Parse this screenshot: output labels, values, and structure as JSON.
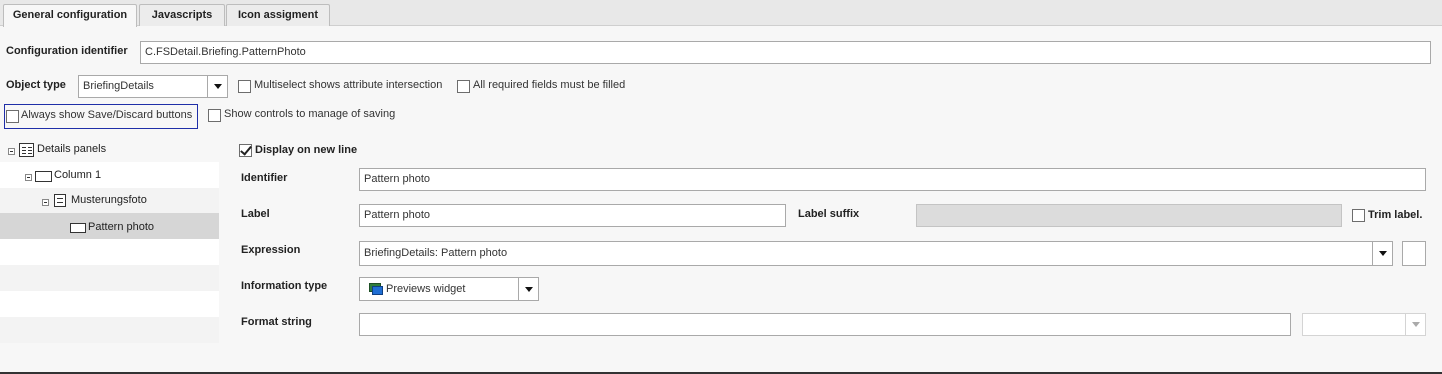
{
  "tabs": [
    {
      "label": "General configuration",
      "active": true
    },
    {
      "label": "Javascripts",
      "active": false
    },
    {
      "label": "Icon assigment",
      "active": false
    }
  ],
  "config": {
    "identifier_label": "Configuration identifier",
    "identifier_value": "C.FSDetail.Briefing.PatternPhoto",
    "object_type_label": "Object type",
    "object_type_value": "BriefingDetails",
    "multiselect_label": "Multiselect shows attribute intersection",
    "multiselect_checked": false,
    "required_label": "All required fields must be filled",
    "required_checked": false,
    "always_save_label": "Always show Save/Discard buttons",
    "always_save_checked": false,
    "show_controls_label": "Show controls to manage of saving",
    "show_controls_checked": false
  },
  "tree": {
    "items": [
      {
        "label": "Details panels",
        "icon": "panel-grid-icon",
        "level": 0
      },
      {
        "label": "Column 1",
        "icon": "column-icon",
        "level": 1
      },
      {
        "label": "Musterungsfoto",
        "icon": "document-icon",
        "level": 2
      },
      {
        "label": "Pattern photo",
        "icon": "field-icon",
        "level": 3,
        "selected": true
      }
    ]
  },
  "detail": {
    "display_new_line_label": "Display on new line",
    "display_new_line_checked": true,
    "identifier_label": "Identifier",
    "identifier_value": "Pattern photo",
    "label_label": "Label",
    "label_value": "Pattern photo",
    "label_suffix_label": "Label suffix",
    "label_suffix_value": "",
    "trim_label": "Trim label.",
    "trim_checked": false,
    "expression_label": "Expression",
    "expression_value": "BriefingDetails: Pattern photo",
    "info_type_label": "Information type",
    "info_type_value": "Previews widget",
    "info_type_icon": "previews-widget-icon",
    "format_string_label": "Format string",
    "format_string_value": ""
  }
}
